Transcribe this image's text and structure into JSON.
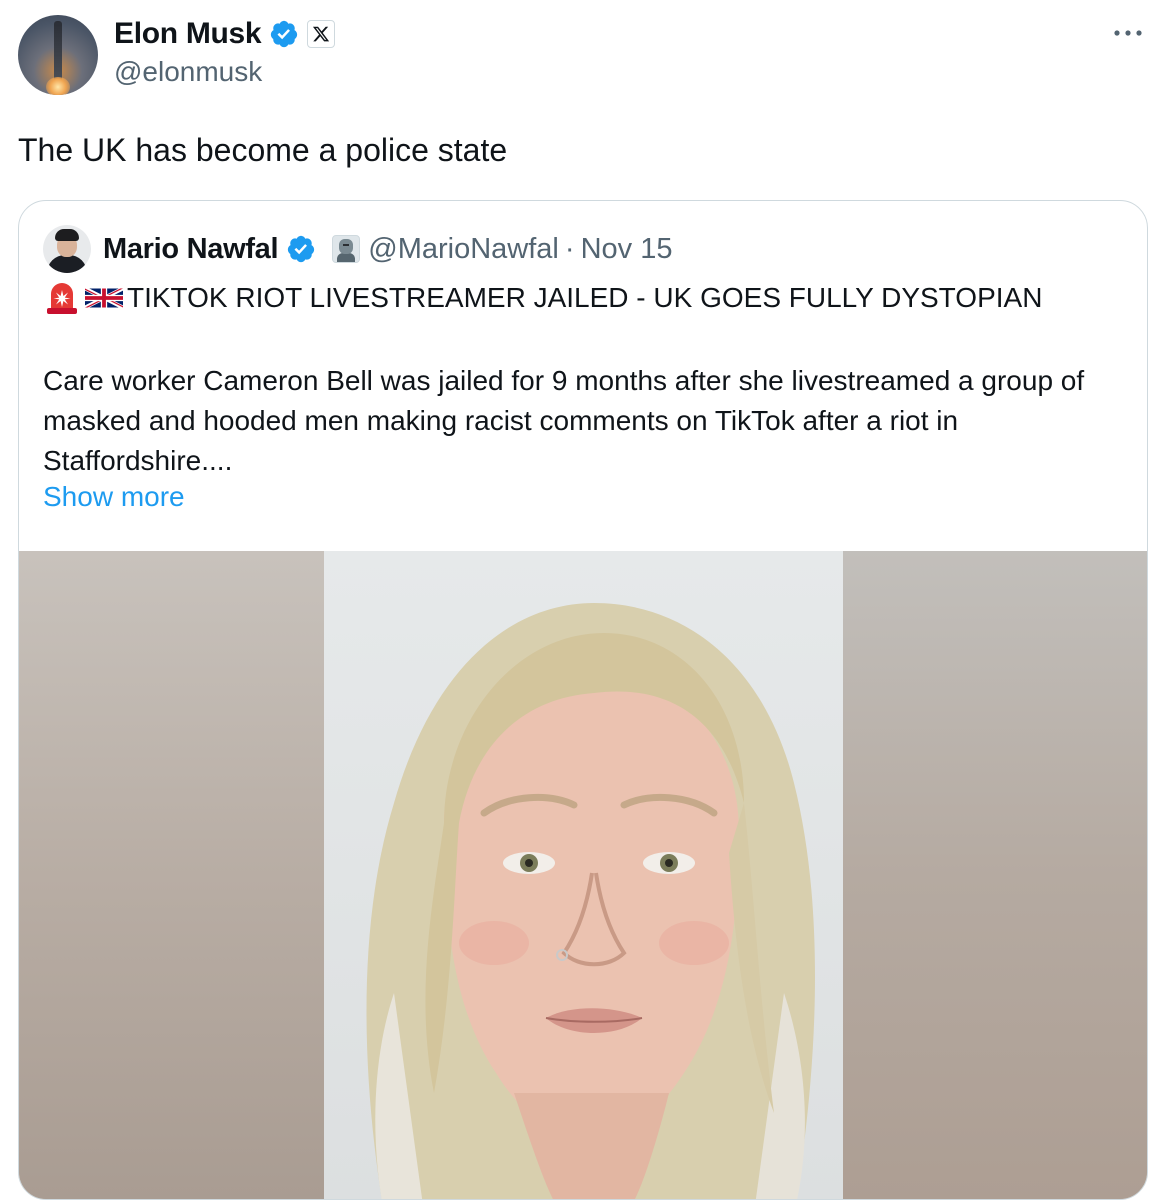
{
  "author": {
    "display_name": "Elon Musk",
    "handle": "@elonmusk",
    "avatar_icon": "starship-avatar",
    "verified_icon": "verified-badge-icon",
    "affiliation_icon": "x-logo-icon"
  },
  "tweet": {
    "text": "The UK has become a police state"
  },
  "menu": {
    "more_icon": "more-options-icon"
  },
  "quote": {
    "display_name": "Mario Nawfal",
    "handle": "@MarioNawfal",
    "separator": "·",
    "date": "Nov 15",
    "headline": "TIKTOK RIOT LIVESTREAMER JAILED - UK GOES FULLY DYSTOPIAN",
    "headline_icons": [
      "siren-icon",
      "uk-flag-icon"
    ],
    "body": "Care worker Cameron Bell was jailed for 9 months after she livestreamed a group of masked and hooded men making racist comments on TikTok after a riot in Staffordshire....",
    "show_more": "Show more",
    "media_description": "custody-photo"
  },
  "colors": {
    "text_primary": "#0f1419",
    "text_secondary": "#536471",
    "link": "#1d9bf0",
    "verified": "#1d9bf0",
    "border": "#cfd9de"
  }
}
